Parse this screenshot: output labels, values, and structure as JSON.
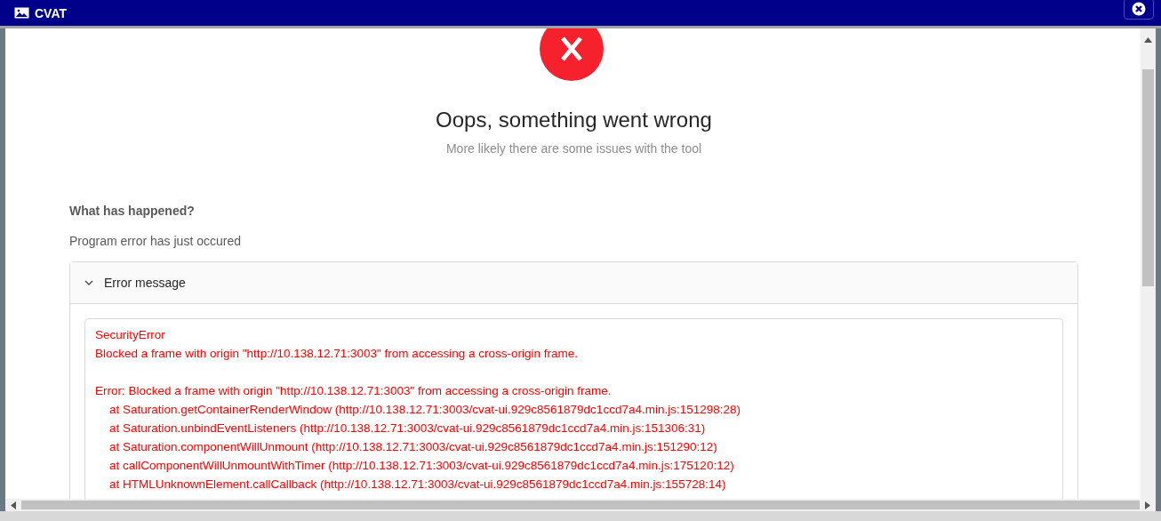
{
  "window": {
    "title": "CVAT"
  },
  "error_page": {
    "title": "Oops, something went wrong",
    "subtitle": "More likely there are some issues with the tool",
    "section_heading": "What has happened?",
    "description": "Program error has just occured"
  },
  "collapse": {
    "header": "Error message",
    "expanded": true,
    "lines": [
      {
        "kind": "text",
        "text": "SecurityError"
      },
      {
        "kind": "text",
        "text": "Blocked a frame with origin \"http://10.138.12.71:3003\" from accessing a cross-origin frame."
      },
      {
        "kind": "blank"
      },
      {
        "kind": "text",
        "text": "Error: Blocked a frame with origin \"http://10.138.12.71:3003\" from accessing a cross-origin frame."
      },
      {
        "kind": "frame",
        "text": "at Saturation.getContainerRenderWindow (http://10.138.12.71:3003/cvat-ui.929c8561879dc1ccd7a4.min.js:151298:28)"
      },
      {
        "kind": "frame",
        "text": "at Saturation.unbindEventListeners (http://10.138.12.71:3003/cvat-ui.929c8561879dc1ccd7a4.min.js:151306:31)"
      },
      {
        "kind": "frame",
        "text": "at Saturation.componentWillUnmount (http://10.138.12.71:3003/cvat-ui.929c8561879dc1ccd7a4.min.js:151290:12)"
      },
      {
        "kind": "frame",
        "text": "at callComponentWillUnmountWithTimer (http://10.138.12.71:3003/cvat-ui.929c8561879dc1ccd7a4.min.js:175120:12)"
      },
      {
        "kind": "frame",
        "text": "at HTMLUnknownElement.callCallback (http://10.138.12.71:3003/cvat-ui.929c8561879dc1ccd7a4.min.js:155728:14)"
      }
    ]
  }
}
